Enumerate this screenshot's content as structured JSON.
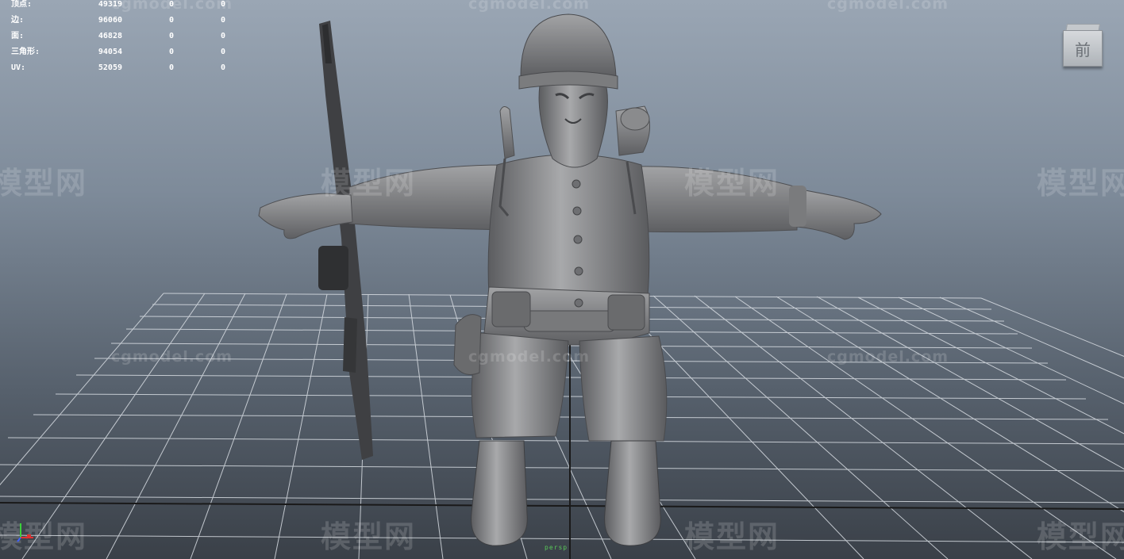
{
  "stats": {
    "rows": [
      {
        "label": "顶点:",
        "value": "49319",
        "c1": "0",
        "c2": "0"
      },
      {
        "label": "边:",
        "value": "96060",
        "c1": "0",
        "c2": "0"
      },
      {
        "label": "面:",
        "value": "46828",
        "c1": "0",
        "c2": "0"
      },
      {
        "label": "三角形:",
        "value": "94054",
        "c1": "0",
        "c2": "0"
      },
      {
        "label": "UV:",
        "value": "52059",
        "c1": "0",
        "c2": "0"
      }
    ]
  },
  "viewcube": {
    "face_label": "前"
  },
  "camera": {
    "name": "persp"
  },
  "watermark": {
    "domain": "cgmodel.com",
    "brand": "模型网"
  },
  "colors": {
    "hud_text": "#ffffff",
    "grid": "#d8dde3",
    "camera_label": "#58c858",
    "model": "#8e8f91"
  }
}
